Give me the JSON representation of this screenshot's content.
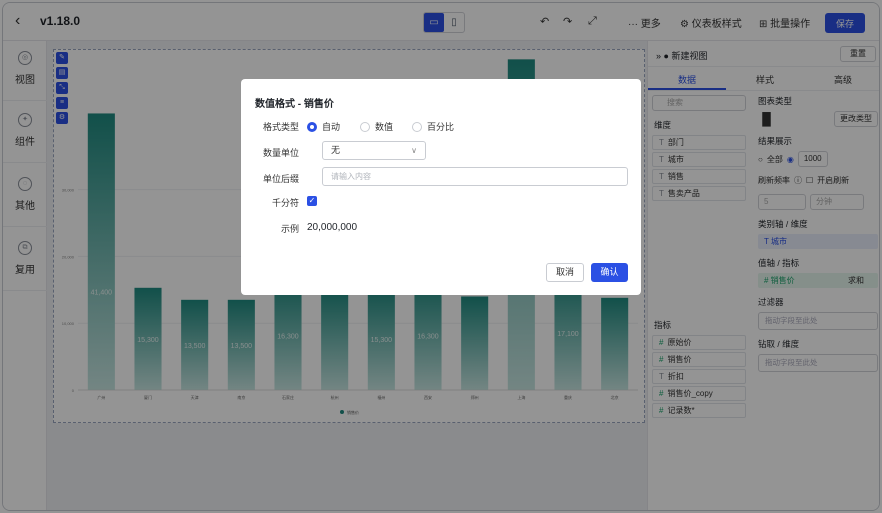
{
  "topbar": {
    "version": "v1.18.0",
    "more": "更多",
    "dashboard_style": "仪表板样式",
    "batch_ops": "批量操作",
    "save": "保存"
  },
  "leftnav": [
    {
      "label": "视图"
    },
    {
      "label": "组件"
    },
    {
      "label": "其他"
    },
    {
      "label": "复用"
    }
  ],
  "right_panel": {
    "title": "新建视图",
    "reset": "重置",
    "tabs": [
      "数据",
      "样式",
      "高级"
    ],
    "search_placeholder": "搜索",
    "dimension_title": "维度",
    "dimensions": [
      "部门",
      "城市",
      "销售",
      "售卖产品"
    ],
    "metric_title": "指标",
    "metrics": [
      "原始价",
      "销售价",
      "折扣",
      "销售价_copy",
      "记录数*"
    ],
    "chart_type_title": "图表类型",
    "change_type": "更改类型",
    "result_title": "结果展示",
    "all": "全部",
    "limit": "1000",
    "refresh_title": "刷新频率",
    "enable_refresh": "开启刷新",
    "refresh_value": "5",
    "refresh_unit": "分钟",
    "category_axis_title": "类别轴 / 维度",
    "category_field": "城市",
    "value_axis_title": "值轴 / 指标",
    "value_field": "销售价",
    "value_agg": "求和",
    "filter_title": "过滤器",
    "filter_placeholder": "拖动字段至此处",
    "drill_title": "钻取 / 维度",
    "drill_placeholder": "拖动字段至此处"
  },
  "modal": {
    "title": "数值格式 - 销售价",
    "format_type_label": "格式类型",
    "format_options": [
      "自动",
      "数值",
      "百分比"
    ],
    "unit_label": "数量单位",
    "unit_value": "无",
    "suffix_label": "单位后缀",
    "suffix_placeholder": "请输入内容",
    "thousands_label": "千分符",
    "example_label": "示例",
    "example_value": "20,000,000",
    "cancel": "取消",
    "ok": "确认"
  },
  "colors": {
    "accent": "#2b50e4",
    "bar_top": "#1f8a80",
    "bar_bottom": "#c7e6e2"
  },
  "chart_data": {
    "type": "bar",
    "categories": [
      "广州",
      "厦门",
      "天津",
      "南京",
      "石家庄",
      "杭州",
      "福州",
      "西安",
      "郑州",
      "上海",
      "重庆",
      "北京"
    ],
    "series": [
      {
        "name": "销售价",
        "values": [
          41400,
          15300,
          13500,
          13500,
          16300,
          15000,
          15300,
          16300,
          14000,
          49500,
          17100,
          13800
        ]
      }
    ],
    "data_labels": [
      "41,400",
      "15,300",
      "13,500",
      "13,500",
      "16,300",
      "",
      "15,300",
      "16,300",
      "",
      "",
      "17,100",
      ""
    ],
    "y_ticks": [
      "0",
      "10,000",
      "20,000",
      "30,000"
    ],
    "ylim": [
      0,
      50000
    ],
    "legend_position": "bottom",
    "grid": true
  }
}
